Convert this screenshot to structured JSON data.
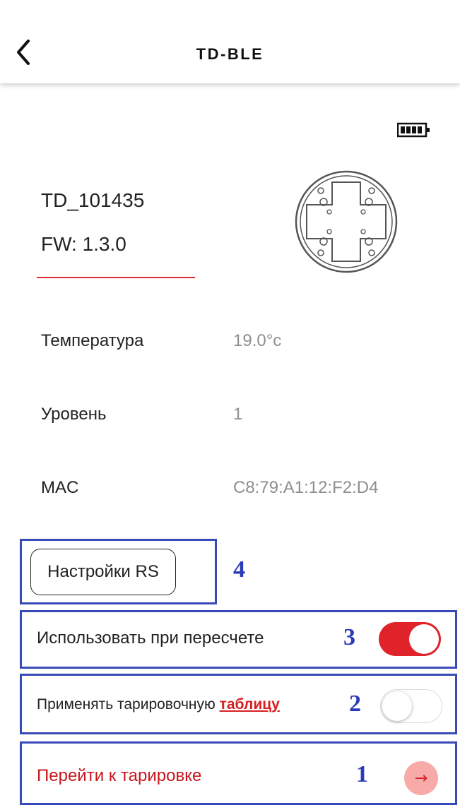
{
  "header": {
    "title": "TD-BLE",
    "back_icon": "chevron-left-icon"
  },
  "status": {
    "indicator_color": "#f4c21d"
  },
  "device": {
    "name": "TD_101435",
    "firmware": "FW: 1.3.0",
    "battery_icon": "battery-full-icon",
    "sensor_icon": "sensor-flange-icon"
  },
  "info": [
    {
      "label": "Температура",
      "value": "19.0°c"
    },
    {
      "label": "Уровень",
      "value": "1"
    },
    {
      "label": "MAC",
      "value": "C8:79:A1:12:F2:D4"
    }
  ],
  "rs_settings": {
    "label": "Настройки RS",
    "number": "4"
  },
  "recalc": {
    "label": "Использовать при пересчете",
    "number": "3",
    "enabled": true
  },
  "table": {
    "label": "Применять тарировочную ",
    "link": "таблицу",
    "number": "2",
    "enabled": false
  },
  "calibrate": {
    "label": "Перейти к тарировке",
    "number": "1",
    "arrow": "→"
  },
  "colors": {
    "accent": "#e0232a",
    "annotation_frame": "#3849b8",
    "annotation_number": "#2b3bb8",
    "value_text": "#8e8e8e"
  }
}
